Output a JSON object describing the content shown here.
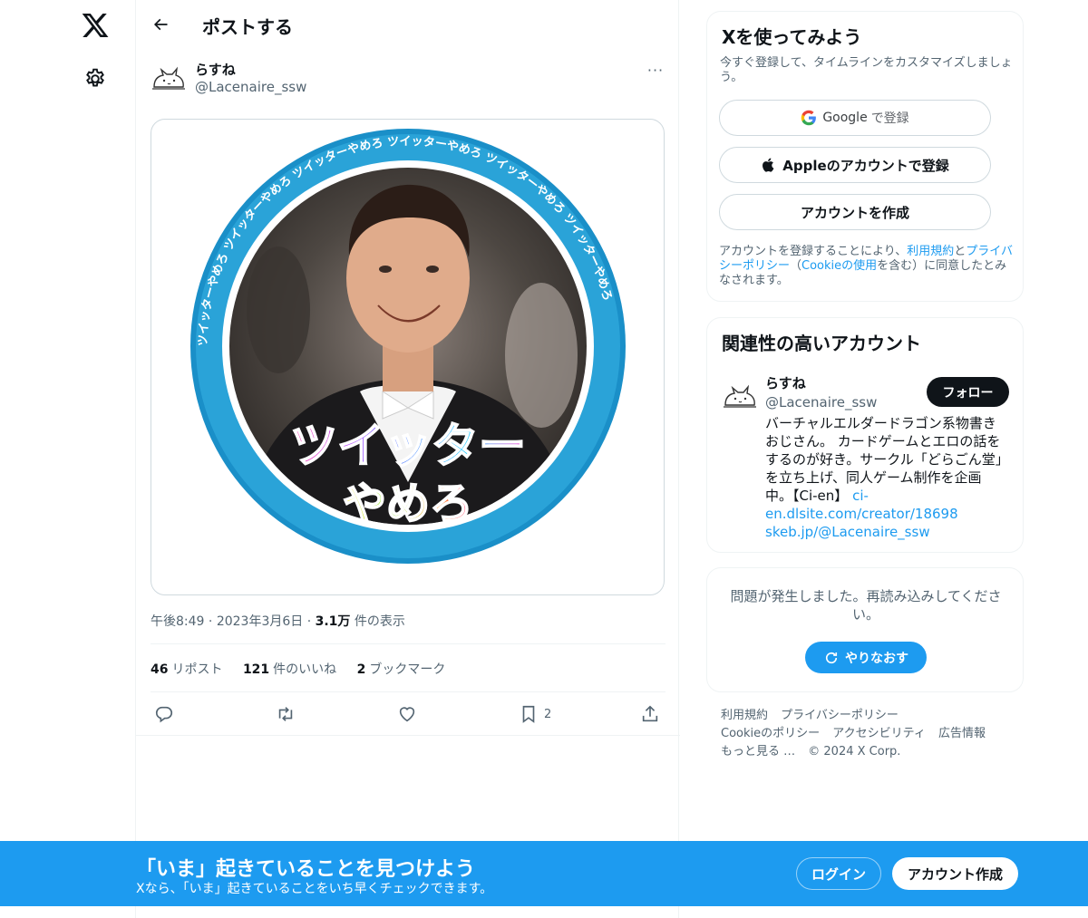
{
  "nav": {
    "logo_icon": "x-logo-icon",
    "settings_icon": "gear-icon"
  },
  "header": {
    "title": "ポストする",
    "back_icon": "arrow-left-icon"
  },
  "post": {
    "author_name": "らすね",
    "author_handle": "@Lacenaire_ssw",
    "more_label": "···",
    "image": {
      "ring_text": "ツイッターやめろ ツイッターやめろ ツイッターやめろ ツイッターやめろ ツイッターやめろ ツイッターやめろ",
      "overlay_line1": "ツイッター",
      "overlay_line2": "やめろ"
    },
    "time": "午後8:49",
    "date": "2023年3月6日",
    "views_count": "3.1万",
    "views_label": "件の表示",
    "stats": {
      "reposts_count": "46",
      "reposts_label": "リポスト",
      "likes_count": "121",
      "likes_label": "件のいいね",
      "bookmarks_count": "2",
      "bookmarks_label": "ブックマーク"
    },
    "actions": {
      "bookmark_count": "2"
    }
  },
  "signup_card": {
    "title": "Xを使ってみよう",
    "subtitle": "今すぐ登録して、タイムラインをカスタマイズしましょう。",
    "google_label": "Google",
    "google_suffix": "で登録",
    "apple_label": "Appleのアカウントで登録",
    "create_label": "アカウントを作成",
    "terms_pre": "アカウントを登録することにより、",
    "terms_link1": "利用規約",
    "terms_mid": "と",
    "terms_link2": "プライバシーポリシー",
    "terms_mid2": "（",
    "terms_link3": "Cookieの使用",
    "terms_post": "を含む）に同意したとみなされます。"
  },
  "related": {
    "title": "関連性の高いアカウント",
    "name": "らすね",
    "handle": "@Lacenaire_ssw",
    "follow_label": "フォロー",
    "bio_text": "バーチャルエルダードラゴン系物書きおじさん。 カードゲームとエロの話をするのが好き。サークル「どらごん堂」を立ち上げ、同人ゲーム制作を企画中。【Ci-en】",
    "bio_link1": "ci-en.dlsite.com/creator/18698",
    "bio_link2": "skeb.jp/@Lacenaire_ssw"
  },
  "error_card": {
    "message": "問題が発生しました。再読み込みしてください。",
    "retry_label": "やりなおす"
  },
  "footer": {
    "links": [
      "利用規約",
      "プライバシーポリシー",
      "Cookieのポリシー",
      "アクセシビリティ",
      "広告情報",
      "もっと見る …",
      "© 2024 X Corp."
    ]
  },
  "banner": {
    "title": "「いま」起きていることを見つけよう",
    "subtitle": "Xなら、「いま」起きていることをいち早くチェックできます。",
    "login_label": "ログイン",
    "signup_label": "アカウント作成"
  },
  "colors": {
    "accent": "#1d9bf0",
    "text": "#0f1419",
    "muted": "#536471",
    "border": "#eff3f4",
    "banner_bg": "#1d9bf0"
  }
}
